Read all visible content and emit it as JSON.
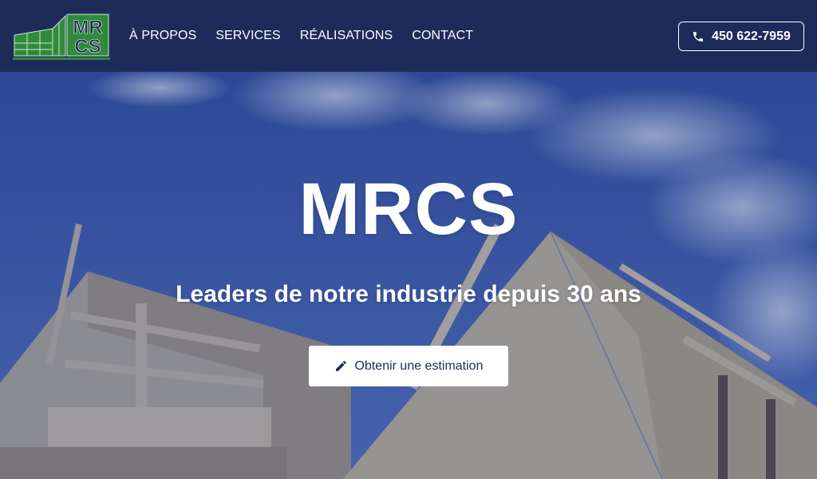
{
  "brand": {
    "logo_line1": "MR",
    "logo_line2": "CS",
    "logo_color": "#2f8a3a"
  },
  "nav": {
    "items": [
      {
        "label": "À PROPOS"
      },
      {
        "label": "SERVICES"
      },
      {
        "label": "RÉALISATIONS"
      },
      {
        "label": "CONTACT"
      }
    ]
  },
  "phone": {
    "number": "450 622-7959",
    "icon": "phone-icon"
  },
  "hero": {
    "title": "MRCS",
    "subtitle": "Leaders de notre industrie depuis 30 ans",
    "cta_label": "Obtenir une estimation",
    "cta_icon": "pencil-icon",
    "background_image": "construction-frame-sky"
  },
  "colors": {
    "header_bg": "#1e2b5a",
    "accent": "#ffffff"
  }
}
